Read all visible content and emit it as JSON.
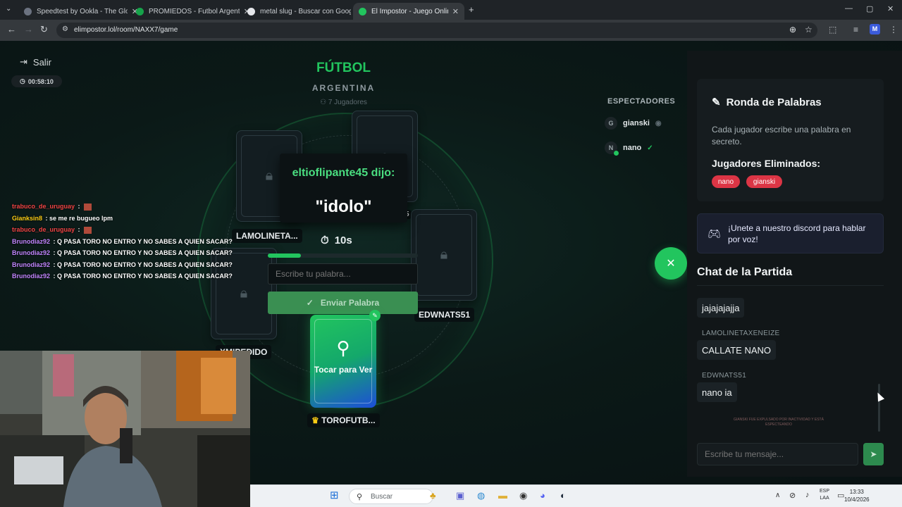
{
  "browser": {
    "tabs": [
      {
        "title": "Speedtest by Ookla - The Global",
        "favicon_color": "#6b7280"
      },
      {
        "title": "PROMIEDOS - Futbol Argentino",
        "favicon_color": "#16a34a"
      },
      {
        "title": "metal slug - Buscar con Google",
        "favicon_color": "#e5e7eb"
      },
      {
        "title": "El Impostor - Juego Online Gra",
        "favicon_color": "#22c55e"
      }
    ],
    "url": "elimpostor.lol/room/NAXX7/game",
    "profile_initial": "M"
  },
  "game": {
    "exit_label": "Salir",
    "timer": "00:58:10",
    "category": "FÚTBOL",
    "subcategory": "ARGENTINA",
    "players_count": "7 Jugadores",
    "players": [
      {
        "name": "LAMOLINETA..."
      },
      {
        "name": "EDWNATS51"
      },
      {
        "name": "XMIPEDIDO"
      },
      {
        "name": "TOROFUTB...",
        "crown": "♛"
      },
      {
        "name": "5"
      }
    ],
    "popup": {
      "who": "eltioflipante45 dijo:",
      "word": "\"idolo\""
    },
    "countdown": "10s",
    "progress_fraction": 0.22,
    "word_input_placeholder": "Escribe tu palabra...",
    "send_word_label": "Enviar Palabra",
    "my_card_label": "Tocar para Ver"
  },
  "spectators": {
    "title": "ESPECTADORES",
    "list": [
      {
        "initial": "G",
        "name": "gianski",
        "icon": "eye-icon"
      },
      {
        "initial": "N",
        "name": "nano",
        "icon": "check-icon"
      }
    ]
  },
  "round": {
    "title": "Ronda de Palabras",
    "description": "Cada jugador escribe una palabra en secreto.",
    "eliminated_title": "Jugadores Eliminados:",
    "eliminated": [
      "nano",
      "gianski"
    ]
  },
  "discord": {
    "text": "¡Unete a nuestro discord para hablar por voz!"
  },
  "chat": {
    "title": "Chat de la Partida",
    "messages": [
      {
        "author": "",
        "text": "jajajajajja"
      },
      {
        "author": "LAMOLINETAXENEIZE",
        "text": "CALLATE NANO"
      },
      {
        "author": "EDWNATS51",
        "text": "nano ia"
      }
    ],
    "system_message": "GIANSKI FUE EXPULSADO POR INACTIVIDAD Y ESTÁ ESPECTEANDO",
    "input_placeholder": "Escribe tu mensaje..."
  },
  "overlay_chat": [
    {
      "user": "trabuco_de_uruguay",
      "text": "",
      "color": "#ef4444",
      "emote": true
    },
    {
      "user": "Gianksin8",
      "text": "se me re bugueo lpm",
      "color": "#facc15",
      "emote": false
    },
    {
      "user": "trabuco_de_uruguay",
      "text": "",
      "color": "#ef4444",
      "emote": true
    },
    {
      "user": "Brunodiaz92",
      "text": "Q PASA TORO NO ENTRO Y NO SABES A QUIEN SACAR?",
      "color": "#c084fc",
      "emote": false
    },
    {
      "user": "Brunodiaz92",
      "text": "Q PASA TORO NO ENTRO Y NO SABES A QUIEN SACAR?",
      "color": "#c084fc",
      "emote": false
    },
    {
      "user": "Brunodiaz92",
      "text": "Q PASA TORO NO ENTRO Y NO SABES A QUIEN SACAR?",
      "color": "#c084fc",
      "emote": false
    },
    {
      "user": "Brunodiaz92",
      "text": "Q PASA TORO NO ENTRO Y NO SABES A QUIEN SACAR?",
      "color": "#c084fc",
      "emote": false
    }
  ],
  "taskbar": {
    "search_placeholder": "Buscar",
    "lang_line1": "ESP",
    "lang_line2": "LAA",
    "time": "13:33",
    "date": "10/4/2026"
  },
  "colors": {
    "accent": "#22c55e",
    "danger": "#dc3545",
    "discord": "#1a1f2e"
  }
}
